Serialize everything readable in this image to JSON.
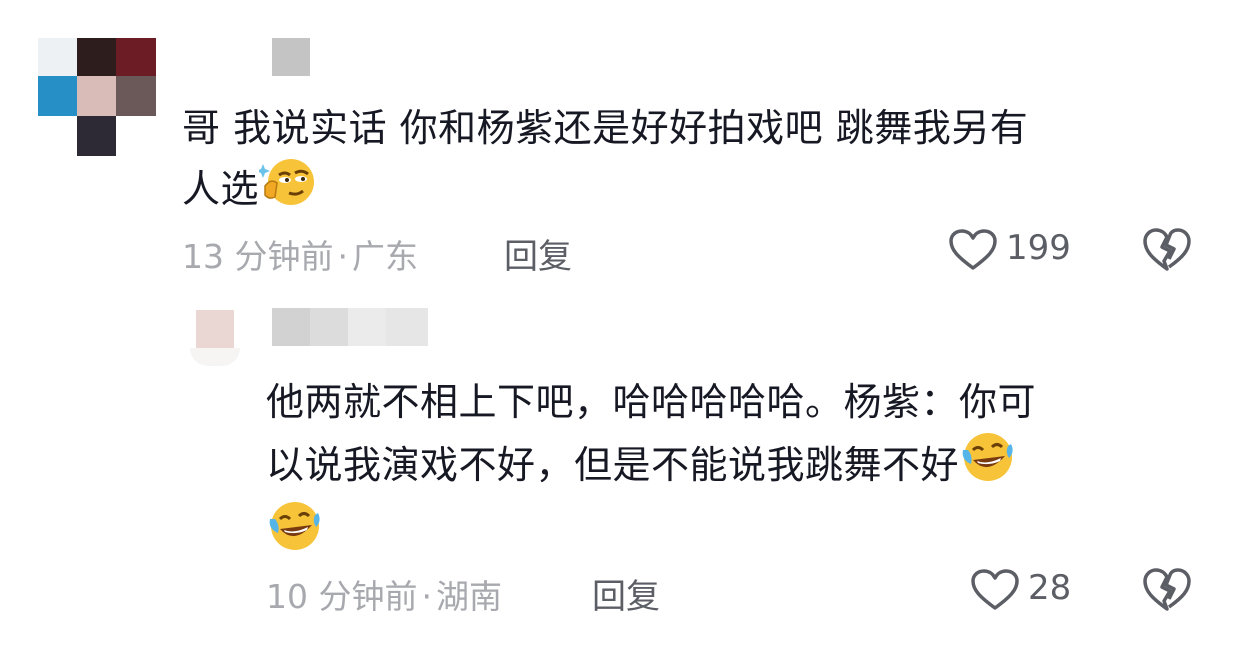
{
  "comments": [
    {
      "text_line1": "哥 我说实话 你和杨紫还是好好拍戏吧 跳舞我另有",
      "text_line2": "人选",
      "emoji": "smirk-emoji",
      "time": "13 分钟前",
      "location": "广东",
      "reply_label": "回复",
      "likes": "199",
      "like_icon": "heart-outline-icon",
      "dislike_icon": "broken-heart-icon"
    },
    {
      "text_line1": "他两就不相上下吧，哈哈哈哈哈。杨紫：你可",
      "text_line2": "以说我演戏不好，但是不能说我跳舞不好",
      "emoji": "rolling-laughing-emoji",
      "time": "10 分钟前",
      "location": "湖南",
      "reply_label": "回复",
      "likes": "28",
      "like_icon": "heart-outline-icon",
      "dislike_icon": "broken-heart-icon"
    }
  ],
  "separator": "·",
  "colors": {
    "text": "#161823",
    "meta": "#a7a9ae",
    "action": "#5c5e66"
  }
}
